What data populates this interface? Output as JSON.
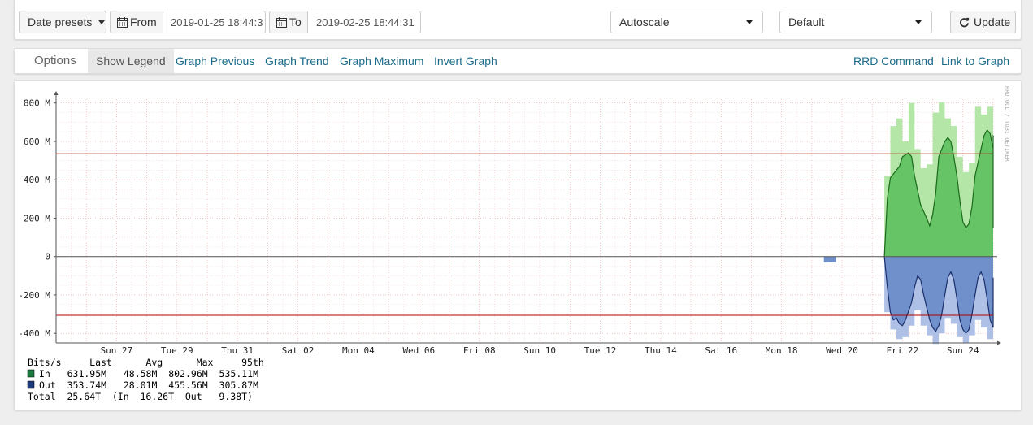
{
  "toolbar": {
    "date_presets": "Date presets",
    "from_label": "From",
    "from_value": "2019-01-25 18:44:3",
    "to_label": "To",
    "to_value": "2019-02-25 18:44:31",
    "scale_select": "Autoscale",
    "profile_select": "Default",
    "update_label": "Update"
  },
  "options": {
    "title": "Options",
    "show_legend": "Show Legend",
    "graph_previous": "Graph Previous",
    "graph_trend": "Graph Trend",
    "graph_maximum": "Graph Maximum",
    "invert_graph": "Invert Graph",
    "rrd_command": "RRD Command",
    "link_to_graph": "Link to Graph"
  },
  "chart_data": {
    "type": "area",
    "watermark": "RRDTOOL / TOBI OETIKER",
    "ylim": [
      -450,
      820
    ],
    "y_ticks": [
      {
        "v": 800,
        "label": "800 M"
      },
      {
        "v": 600,
        "label": "600 M"
      },
      {
        "v": 400,
        "label": "400 M"
      },
      {
        "v": 200,
        "label": "200 M"
      },
      {
        "v": 0,
        "label": "0"
      },
      {
        "v": -200,
        "label": "-200 M"
      },
      {
        "v": -400,
        "label": "-400 M"
      }
    ],
    "x_range_days": [
      0,
      31
    ],
    "x_ticks": [
      {
        "d": 2,
        "label": "Sun 27"
      },
      {
        "d": 4,
        "label": "Tue 29"
      },
      {
        "d": 6,
        "label": "Thu 31"
      },
      {
        "d": 8,
        "label": "Sat 02"
      },
      {
        "d": 10,
        "label": "Mon 04"
      },
      {
        "d": 12,
        "label": "Wed 06"
      },
      {
        "d": 14,
        "label": "Fri 08"
      },
      {
        "d": 16,
        "label": "Sun 10"
      },
      {
        "d": 18,
        "label": "Tue 12"
      },
      {
        "d": 20,
        "label": "Thu 14"
      },
      {
        "d": 22,
        "label": "Sat 16"
      },
      {
        "d": 24,
        "label": "Mon 18"
      },
      {
        "d": 26,
        "label": "Wed 20"
      },
      {
        "d": 28,
        "label": "Fri 22"
      },
      {
        "d": 30,
        "label": "Sun 24"
      }
    ],
    "hlines": [
      535.11,
      -305.87
    ],
    "series": [
      {
        "name": "In",
        "color_fill": "#66c466",
        "color_line": "#1a6b1a",
        "color_max": "#b4e6a8",
        "avg": [
          [
            27.4,
            0
          ],
          [
            27.5,
            300
          ],
          [
            27.6,
            410
          ],
          [
            27.8,
            450
          ],
          [
            27.9,
            470
          ],
          [
            28.0,
            520
          ],
          [
            28.2,
            540
          ],
          [
            28.3,
            520
          ],
          [
            28.4,
            420
          ],
          [
            28.6,
            270
          ],
          [
            28.8,
            200
          ],
          [
            28.9,
            160
          ],
          [
            29.0,
            220
          ],
          [
            29.1,
            330
          ],
          [
            29.2,
            520
          ],
          [
            29.4,
            600
          ],
          [
            29.5,
            620
          ],
          [
            29.6,
            600
          ],
          [
            29.7,
            520
          ],
          [
            29.8,
            420
          ],
          [
            29.9,
            290
          ],
          [
            30.0,
            180
          ],
          [
            30.1,
            150
          ],
          [
            30.2,
            170
          ],
          [
            30.3,
            260
          ],
          [
            30.4,
            420
          ],
          [
            30.6,
            560
          ],
          [
            30.7,
            630
          ],
          [
            30.8,
            660
          ],
          [
            30.9,
            640
          ],
          [
            31.0,
            560
          ],
          [
            31.1,
            420
          ],
          [
            31.2,
            260
          ],
          [
            31.3,
            170
          ],
          [
            31.4,
            150
          ],
          [
            31.5,
            190
          ],
          [
            31.6,
            290
          ],
          [
            31.8,
            460
          ],
          [
            31.9,
            560
          ],
          [
            32.0,
            631.95
          ]
        ],
        "max": [
          [
            27.4,
            0
          ],
          [
            27.4,
            420
          ],
          [
            27.6,
            420
          ],
          [
            27.6,
            680
          ],
          [
            27.8,
            680
          ],
          [
            27.8,
            720
          ],
          [
            28.0,
            720
          ],
          [
            28.0,
            600
          ],
          [
            28.2,
            600
          ],
          [
            28.2,
            800
          ],
          [
            28.4,
            800
          ],
          [
            28.4,
            560
          ],
          [
            28.6,
            560
          ],
          [
            28.6,
            460
          ],
          [
            28.8,
            460
          ],
          [
            28.8,
            480
          ],
          [
            29.0,
            480
          ],
          [
            29.0,
            750
          ],
          [
            29.2,
            750
          ],
          [
            29.2,
            803
          ],
          [
            29.4,
            803
          ],
          [
            29.4,
            720
          ],
          [
            29.6,
            720
          ],
          [
            29.6,
            680
          ],
          [
            29.8,
            680
          ],
          [
            29.8,
            520
          ],
          [
            30.0,
            520
          ],
          [
            30.0,
            440
          ],
          [
            30.2,
            440
          ],
          [
            30.2,
            490
          ],
          [
            30.4,
            490
          ],
          [
            30.4,
            780
          ],
          [
            30.6,
            780
          ],
          [
            30.6,
            740
          ],
          [
            30.8,
            740
          ],
          [
            30.8,
            780
          ],
          [
            31.0,
            780
          ],
          [
            31.0,
            640
          ],
          [
            31.2,
            640
          ],
          [
            31.2,
            500
          ],
          [
            31.4,
            500
          ],
          [
            31.4,
            440
          ],
          [
            31.6,
            440
          ],
          [
            31.6,
            550
          ],
          [
            31.8,
            550
          ],
          [
            31.8,
            620
          ],
          [
            32.0,
            620
          ],
          [
            32.0,
            0
          ]
        ]
      },
      {
        "name": "Out",
        "color_fill": "#7090cc",
        "color_line": "#1a2f6b",
        "color_max": "#aec0e6",
        "avg": [
          [
            27.4,
            0
          ],
          [
            27.5,
            -160
          ],
          [
            27.6,
            -290
          ],
          [
            27.7,
            -330
          ],
          [
            27.8,
            -320
          ],
          [
            27.9,
            -350
          ],
          [
            28.0,
            -360
          ],
          [
            28.1,
            -330
          ],
          [
            28.3,
            -240
          ],
          [
            28.4,
            -160
          ],
          [
            28.5,
            -100
          ],
          [
            28.6,
            -120
          ],
          [
            28.7,
            -200
          ],
          [
            28.9,
            -330
          ],
          [
            29.0,
            -370
          ],
          [
            29.1,
            -390
          ],
          [
            29.2,
            -360
          ],
          [
            29.3,
            -300
          ],
          [
            29.4,
            -200
          ],
          [
            29.5,
            -110
          ],
          [
            29.6,
            -80
          ],
          [
            29.7,
            -120
          ],
          [
            29.8,
            -220
          ],
          [
            29.9,
            -330
          ],
          [
            30.0,
            -380
          ],
          [
            30.1,
            -400
          ],
          [
            30.2,
            -380
          ],
          [
            30.3,
            -300
          ],
          [
            30.4,
            -200
          ],
          [
            30.5,
            -110
          ],
          [
            30.6,
            -80
          ],
          [
            30.7,
            -120
          ],
          [
            30.8,
            -220
          ],
          [
            30.9,
            -330
          ],
          [
            31.0,
            -370
          ],
          [
            31.1,
            -370
          ],
          [
            31.2,
            -330
          ],
          [
            31.3,
            -250
          ],
          [
            31.4,
            -170
          ],
          [
            31.5,
            -110
          ],
          [
            31.6,
            -140
          ],
          [
            31.7,
            -230
          ],
          [
            31.8,
            -290
          ],
          [
            31.9,
            -320
          ],
          [
            32.0,
            -353.74
          ]
        ],
        "max": [
          [
            27.4,
            0
          ],
          [
            27.4,
            -290
          ],
          [
            27.6,
            -290
          ],
          [
            27.6,
            -380
          ],
          [
            27.8,
            -380
          ],
          [
            27.8,
            -430
          ],
          [
            28.0,
            -430
          ],
          [
            28.0,
            -420
          ],
          [
            28.2,
            -420
          ],
          [
            28.2,
            -360
          ],
          [
            28.4,
            -360
          ],
          [
            28.4,
            -280
          ],
          [
            28.6,
            -280
          ],
          [
            28.6,
            -360
          ],
          [
            28.8,
            -360
          ],
          [
            28.8,
            -410
          ],
          [
            29.0,
            -410
          ],
          [
            29.0,
            -455
          ],
          [
            29.2,
            -455
          ],
          [
            29.2,
            -400
          ],
          [
            29.4,
            -400
          ],
          [
            29.4,
            -320
          ],
          [
            29.6,
            -320
          ],
          [
            29.6,
            -350
          ],
          [
            29.8,
            -350
          ],
          [
            29.8,
            -420
          ],
          [
            30.0,
            -420
          ],
          [
            30.0,
            -450
          ],
          [
            30.2,
            -450
          ],
          [
            30.2,
            -410
          ],
          [
            30.4,
            -410
          ],
          [
            30.4,
            -330
          ],
          [
            30.6,
            -330
          ],
          [
            30.6,
            -370
          ],
          [
            30.8,
            -370
          ],
          [
            30.8,
            -430
          ],
          [
            31.0,
            -430
          ],
          [
            31.0,
            -440
          ],
          [
            31.2,
            -440
          ],
          [
            31.2,
            -390
          ],
          [
            31.4,
            -390
          ],
          [
            31.4,
            -330
          ],
          [
            31.6,
            -330
          ],
          [
            31.6,
            -380
          ],
          [
            31.8,
            -380
          ],
          [
            31.8,
            -350
          ],
          [
            32.0,
            -350
          ],
          [
            32.0,
            0
          ]
        ],
        "blip": [
          [
            25.4,
            0
          ],
          [
            25.4,
            -30
          ],
          [
            25.8,
            -30
          ],
          [
            25.8,
            0
          ]
        ]
      }
    ],
    "legend": {
      "header": "Bits/s     Last      Avg      Max     95th",
      "rows": [
        {
          "name": "In",
          "color": "#1b7a3e",
          "text": "In   631.95M   48.58M  802.96M  535.11M"
        },
        {
          "name": "Out",
          "color": "#1e3a7a",
          "text": "Out  353.74M   28.01M  455.56M  305.87M"
        }
      ],
      "total": "Total  25.64T  (In  16.26T  Out   9.38T)"
    }
  }
}
